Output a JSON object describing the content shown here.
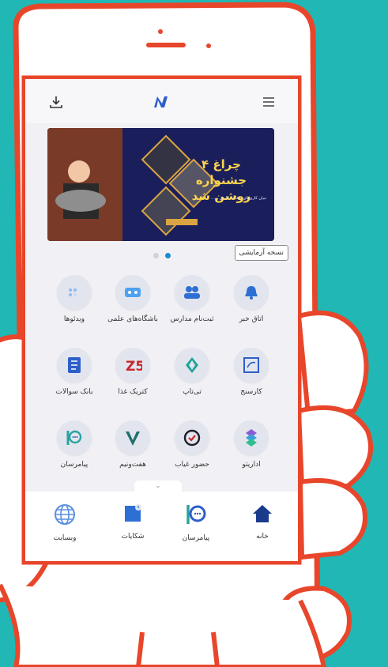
{
  "topbar": {
    "download_icon": "download-icon",
    "logo_icon": "n-logo-icon",
    "menu_icon": "hamburger-menu-icon"
  },
  "banner": {
    "title": "چراغ ۴ جشنواره روشن شد",
    "subtitle": "تبیان کاری‌های، رقابت کارش و ...",
    "slide_index": 2,
    "slide_count": 2
  },
  "trial_badge": "نسخه آزمایشی",
  "grid": [
    {
      "label": "اتاق خبر",
      "icon": "bell-icon"
    },
    {
      "label": "ثبت‌نام مدارس",
      "icon": "people-icon"
    },
    {
      "label": "باشگاه‌های علمی",
      "icon": "club-icon"
    },
    {
      "label": "ویدئوها",
      "icon": "video-icon"
    },
    {
      "label": "کارسنج",
      "icon": "karsanj-icon"
    },
    {
      "label": "تی‌تاپ",
      "icon": "titap-icon"
    },
    {
      "label": "کتریک غذا",
      "icon": "food-icon"
    },
    {
      "label": "بانک سوالات",
      "icon": "question-bank-icon"
    },
    {
      "label": "اداریتو",
      "icon": "adarito-icon"
    },
    {
      "label": "حضور غیاب",
      "icon": "attendance-icon"
    },
    {
      "label": "هفت‌ونیم",
      "icon": "haftonim-icon"
    },
    {
      "label": "پیامرسان",
      "icon": "messenger-icon"
    }
  ],
  "bottom_nav": [
    {
      "label": "خانه",
      "icon": "home-icon"
    },
    {
      "label": "پیامرسان",
      "icon": "messenger-icon"
    },
    {
      "label": "شکایات",
      "icon": "complaints-icon"
    },
    {
      "label": "وبسایت",
      "icon": "globe-icon"
    }
  ],
  "colors": {
    "background": "#20b7b4",
    "phone_outline": "#e8462b",
    "accent_blue": "#2d6fd4",
    "banner_bg": "#1a1f5c",
    "banner_title": "#ffd34d"
  }
}
